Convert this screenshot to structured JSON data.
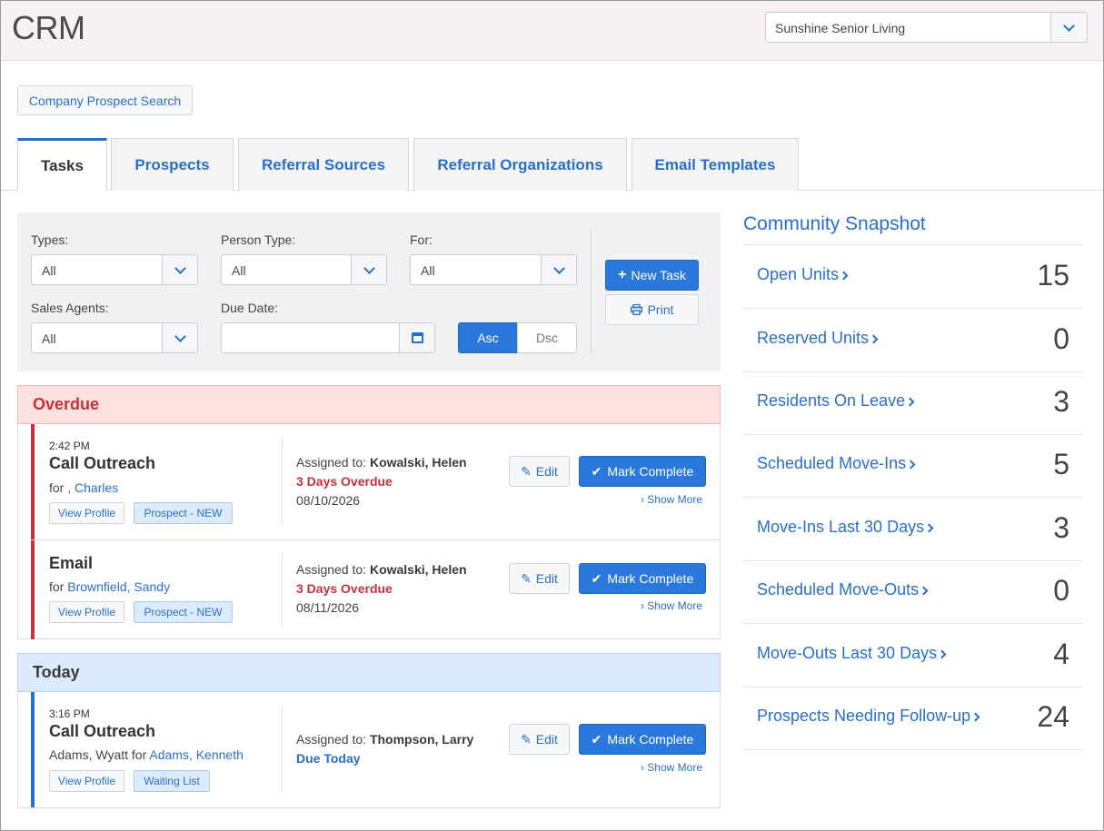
{
  "header": {
    "title": "CRM",
    "community": "Sunshine Senior Living"
  },
  "company_prospect_search": "Company Prospect Search",
  "tabs": [
    {
      "label": "Tasks",
      "active": true
    },
    {
      "label": "Prospects"
    },
    {
      "label": "Referral Sources"
    },
    {
      "label": "Referral Organizations"
    },
    {
      "label": "Email Templates"
    }
  ],
  "filters": {
    "types_label": "Types:",
    "types_value": "All",
    "person_type_label": "Person Type:",
    "person_type_value": "All",
    "for_label": "For:",
    "for_value": "All",
    "sales_agents_label": "Sales Agents:",
    "sales_agents_value": "All",
    "due_date_label": "Due Date:",
    "due_date_value": "",
    "asc": "Asc",
    "dsc": "Dsc",
    "sort_selected": "Asc",
    "new_task": "New Task",
    "print": "Print"
  },
  "groups": {
    "overdue": {
      "title": "Overdue",
      "tasks": [
        {
          "time": "2:42 PM",
          "type": "Call Outreach",
          "for_prefix": "for ",
          "for_link": ", Charles",
          "view_profile": "View Profile",
          "status": "Prospect - NEW",
          "assigned_label": "Assigned to:",
          "assigned_to": "Kowalski, Helen",
          "due_flag": "3 Days Overdue",
          "date": "08/10/2026",
          "edit": "Edit",
          "mark_complete": "Mark Complete",
          "show_more": "Show More"
        },
        {
          "time": "",
          "type": "Email",
          "for_prefix": "for ",
          "for_link": "Brownfield, Sandy",
          "view_profile": "View Profile",
          "status": "Prospect - NEW",
          "assigned_label": "Assigned to:",
          "assigned_to": "Kowalski, Helen",
          "due_flag": "3 Days Overdue",
          "date": "08/11/2026",
          "edit": "Edit",
          "mark_complete": "Mark Complete",
          "show_more": "Show More"
        }
      ]
    },
    "today": {
      "title": "Today",
      "tasks": [
        {
          "time": "3:16 PM",
          "type": "Call Outreach",
          "for_prefix": "Adams, Wyatt for ",
          "for_link": "Adams, Kenneth",
          "view_profile": "View Profile",
          "status": "Waiting List",
          "assigned_label": "Assigned to:",
          "assigned_to": "Thompson, Larry",
          "due_flag": "Due Today",
          "date": "",
          "edit": "Edit",
          "mark_complete": "Mark Complete",
          "show_more": "Show More"
        }
      ]
    }
  },
  "snapshot": {
    "title": "Community Snapshot",
    "rows": [
      {
        "label": "Open Units",
        "value": "15"
      },
      {
        "label": "Reserved Units",
        "value": "0"
      },
      {
        "label": "Residents On Leave",
        "value": "3"
      },
      {
        "label": "Scheduled Move-Ins",
        "value": "5"
      },
      {
        "label": "Move-Ins Last 30 Days",
        "value": "3"
      },
      {
        "label": "Scheduled Move-Outs",
        "value": "0"
      },
      {
        "label": "Move-Outs Last 30 Days",
        "value": "4"
      },
      {
        "label": "Prospects Needing Follow-up",
        "value": "24"
      }
    ]
  },
  "colors": {
    "accent": "#2b78dc",
    "link": "#2a6fc9",
    "overdue": "#c8313b",
    "overdue_bg": "#fde0df",
    "today_bg": "#dcebfb"
  }
}
